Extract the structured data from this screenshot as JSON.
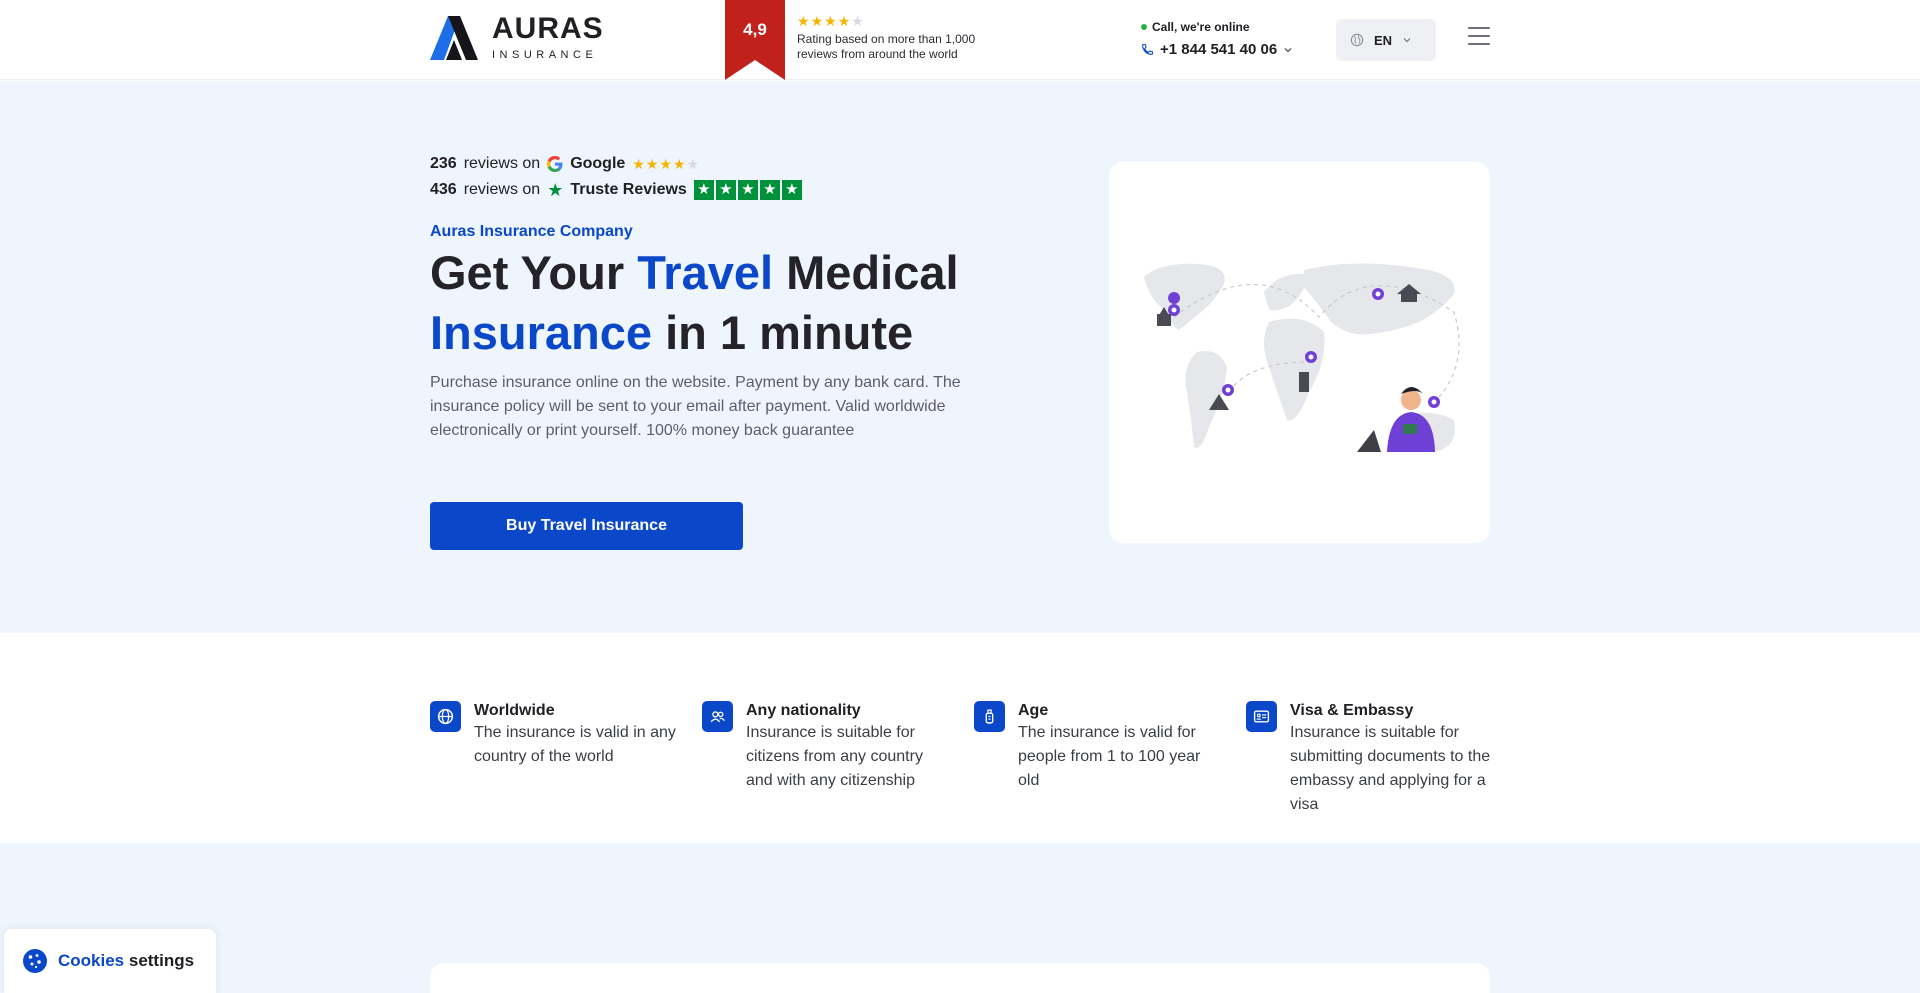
{
  "header": {
    "logo_title": "AURAS",
    "logo_sub": "INSURANCE",
    "rating_value": "4,9",
    "rating_stars": 4,
    "rating_text": "Rating based on more than 1,000 reviews from around the world",
    "call_label": "Call, we're online",
    "phone": "+1 844 541 40 06",
    "language": "EN"
  },
  "hero": {
    "reviews": [
      {
        "count": "236",
        "on": "reviews on",
        "source": "Google",
        "stars": 4
      },
      {
        "count": "436",
        "on": "reviews on",
        "source": "Truste Reviews",
        "stars": 5
      }
    ],
    "company": "Auras Insurance Company",
    "headline_1": "Get Your ",
    "headline_blue_1": "Travel",
    "headline_2": " Medical",
    "headline_blue_2": "Insurance",
    "headline_3": " in 1 minute",
    "description": "Purchase insurance online on the website. Payment by any bank card. The insurance policy will be sent to your email after payment. Valid worldwide electronically or print yourself. 100% money back guarantee",
    "cta": "Buy Travel Insurance"
  },
  "features": [
    {
      "icon": "globe-icon",
      "title": "Worldwide",
      "text": "The insurance is valid in any country of the world"
    },
    {
      "icon": "users-icon",
      "title": "Any nationality",
      "text": "Insurance is suitable for citizens from any country and with any citizenship"
    },
    {
      "icon": "baby-bottle-icon",
      "title": "Age",
      "text": "The insurance is valid for people from 1 to 100 year old"
    },
    {
      "icon": "id-card-icon",
      "title": "Visa & Embassy",
      "text": "Insurance is suitable for submitting documents to the embassy and applying for a visa"
    }
  ],
  "cookies": {
    "highlight": "Cookies",
    "rest": " settings"
  },
  "colors": {
    "brand": "#0a47c9",
    "ribbon": "#c0211b",
    "hero_bg": "#eef5fd",
    "star": "#f5b400",
    "trust": "#00913b"
  }
}
